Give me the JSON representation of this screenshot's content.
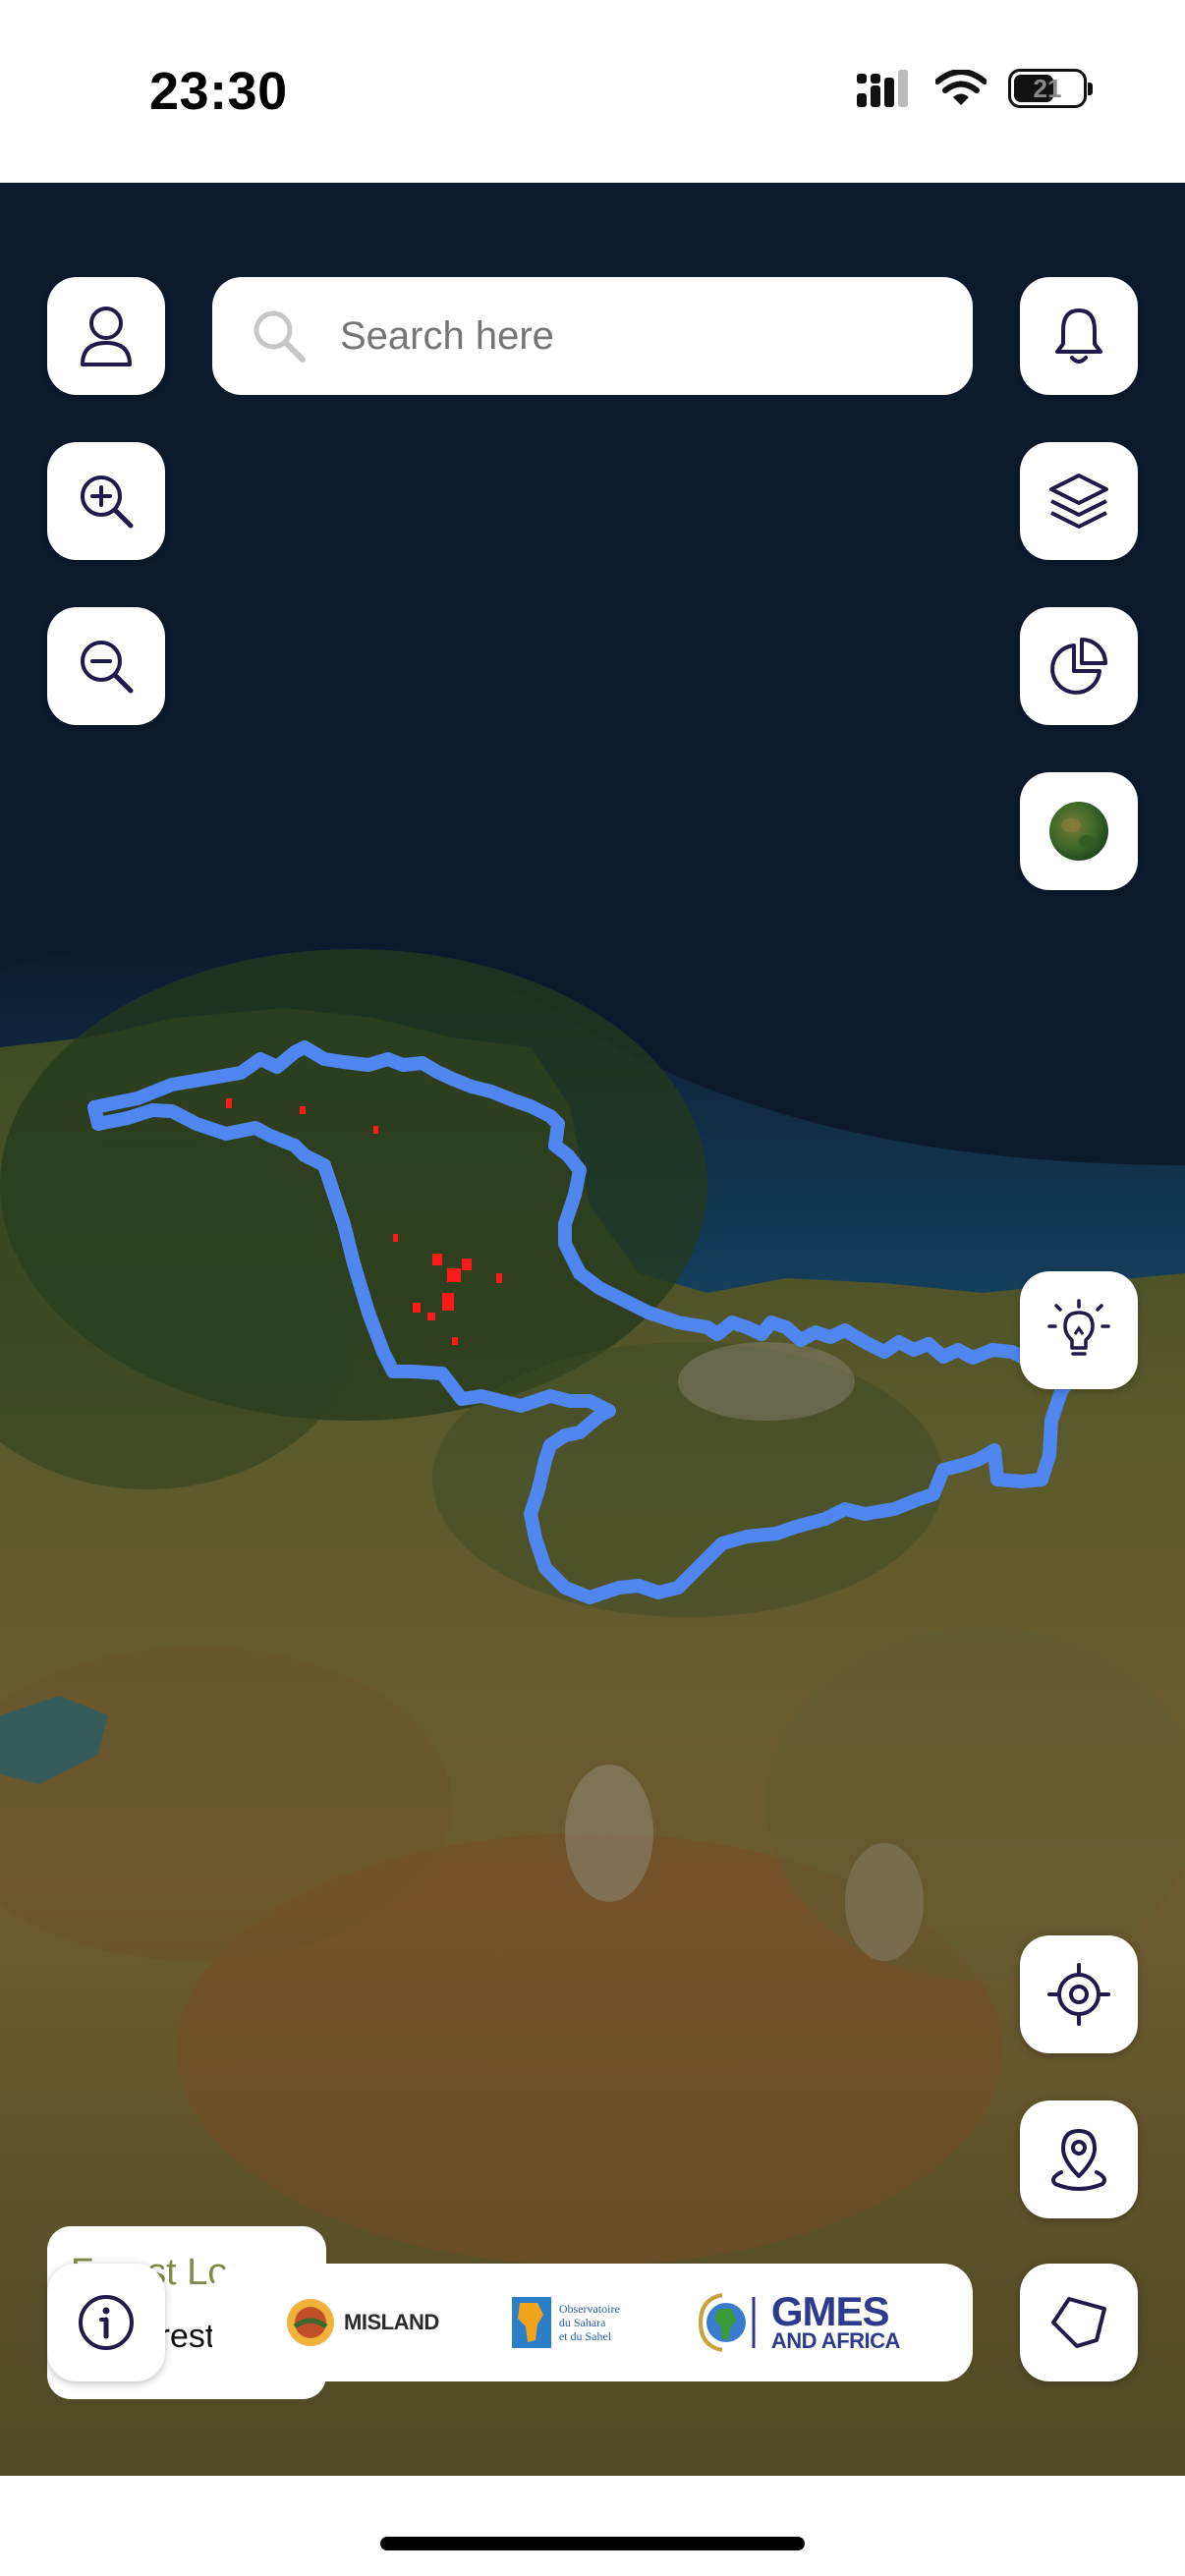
{
  "status_bar": {
    "time": "23:30",
    "battery": "21"
  },
  "search": {
    "placeholder": "Search here"
  },
  "controls": {
    "profile": "user-icon",
    "zoom_in": "zoom-in-icon",
    "zoom_out": "zoom-out-icon",
    "notifications": "bell-icon",
    "layers": "layers-icon",
    "statistics": "pie-chart-icon",
    "basemap": "globe-thumbnail-icon",
    "insights": "lightbulb-icon",
    "locate": "crosshair-icon",
    "pin": "location-pin-icon",
    "info": "info-icon",
    "draw_polygon": "polygon-icon"
  },
  "legend": {
    "title": "Forest Loss",
    "items": [
      {
        "label": "Forest Loss",
        "color": "#f20000"
      }
    ]
  },
  "partners": {
    "misland": "MISLAND",
    "oss_line1": "Observatoire",
    "oss_line2": "du Sahara",
    "oss_line3": "et du Sahel",
    "gmes_line1": "GMES",
    "gmes_line2": "AND AFRICA"
  },
  "map": {
    "boundary_color": "#4f86f0",
    "forest_loss_color": "#ff1a1a",
    "sea_color": "#0c1a2e"
  }
}
